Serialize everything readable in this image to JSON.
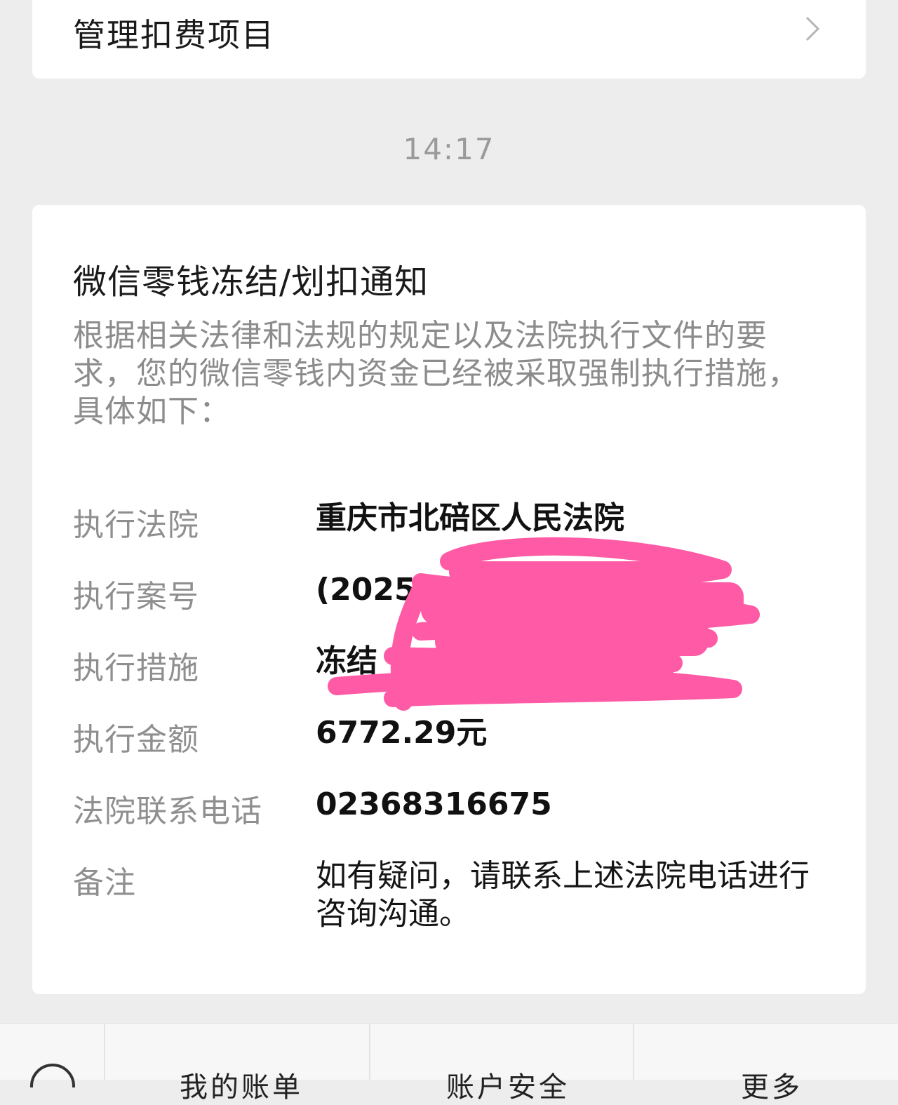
{
  "top_card": {
    "title": "管理扣费项目"
  },
  "timestamp": "14:17",
  "notice": {
    "title": "微信零钱冻结/划扣通知",
    "description": "根据相关法律和法规的规定以及法院执行文件的要求，您的微信零钱内资金已经被采取强制执行措施，具体如下：",
    "rows": [
      {
        "label": "执行法院",
        "value": "重庆市北碚区人民法院"
      },
      {
        "label": "执行案号",
        "value": "(2025)"
      },
      {
        "label": "执行措施",
        "value": "冻结"
      },
      {
        "label": "执行金额",
        "value": "6772.29元"
      },
      {
        "label": "法院联系电话",
        "value": "02368316675"
      },
      {
        "label": "备注",
        "value": "如有疑问，请联系上述法院电话进行咨询沟通。"
      }
    ]
  },
  "bottom_bar": {
    "menus": [
      "我的账单",
      "账户安全",
      "更多"
    ]
  },
  "colors": {
    "redaction": "#ff5aa5",
    "background": "#ededed"
  }
}
